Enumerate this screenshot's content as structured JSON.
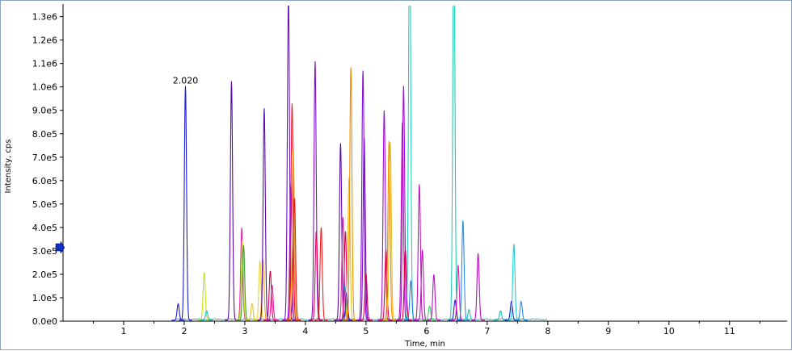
{
  "chart_data": {
    "type": "line",
    "title": "",
    "xlabel": "Time, min",
    "ylabel": "Intensity, cps",
    "xlim": [
      0,
      11.95
    ],
    "ylim": [
      0,
      1340000
    ],
    "x_ticks": [
      1,
      2,
      3,
      4,
      5,
      6,
      7,
      8,
      9,
      10,
      11
    ],
    "y_ticks": [
      0,
      100000,
      200000,
      300000,
      400000,
      500000,
      600000,
      700000,
      800000,
      900000,
      1000000,
      1100000,
      1200000,
      1300000
    ],
    "y_tick_labels": [
      "0.0e0",
      "1.0e5",
      "2.0e5",
      "3.0e5",
      "4.0e5",
      "5.0e5",
      "6.0e5",
      "7.0e5",
      "8.0e5",
      "9.0e5",
      "1.0e6",
      "1.1e6",
      "1.2e6",
      "1.3e6"
    ],
    "grid": false,
    "legend": "none",
    "annotations": [
      {
        "text": "2.020",
        "x": 2.02,
        "y": 1000000
      }
    ],
    "peaks": [
      {
        "rt": 2.02,
        "height": 1000000,
        "color": "#1c1cd0"
      },
      {
        "rt": 1.9,
        "height": 70000,
        "color": "#1c1cd0"
      },
      {
        "rt": 2.33,
        "height": 205000,
        "color": "#c0e020"
      },
      {
        "rt": 2.37,
        "height": 40000,
        "color": "#20c0c0"
      },
      {
        "rt": 2.78,
        "height": 1020000,
        "color": "#5a0aa8"
      },
      {
        "rt": 2.95,
        "height": 395000,
        "color": "#e020b0"
      },
      {
        "rt": 2.96,
        "height": 340000,
        "color": "#c0e020"
      },
      {
        "rt": 2.98,
        "height": 320000,
        "color": "#40a030"
      },
      {
        "rt": 3.12,
        "height": 70000,
        "color": "#e8c020"
      },
      {
        "rt": 3.25,
        "height": 255000,
        "color": "#e8d040"
      },
      {
        "rt": 3.3,
        "height": 260000,
        "color": "#e8a020"
      },
      {
        "rt": 3.32,
        "height": 905000,
        "color": "#5a0aa8"
      },
      {
        "rt": 3.42,
        "height": 210000,
        "color": "#e00050"
      },
      {
        "rt": 3.45,
        "height": 150000,
        "color": "#e020b0"
      },
      {
        "rt": 3.72,
        "height": 1380000,
        "color": "#7010c0"
      },
      {
        "rt": 3.76,
        "height": 580000,
        "color": "#a000e0"
      },
      {
        "rt": 3.78,
        "height": 925000,
        "color": "#e82020"
      },
      {
        "rt": 3.8,
        "height": 730000,
        "color": "#e8a020"
      },
      {
        "rt": 3.82,
        "height": 520000,
        "color": "#e82020"
      },
      {
        "rt": 4.16,
        "height": 1105000,
        "color": "#8010d0"
      },
      {
        "rt": 4.18,
        "height": 380000,
        "color": "#e00050"
      },
      {
        "rt": 4.26,
        "height": 395000,
        "color": "#e82020"
      },
      {
        "rt": 4.58,
        "height": 755000,
        "color": "#5a0aa8"
      },
      {
        "rt": 4.62,
        "height": 440000,
        "color": "#e020b0"
      },
      {
        "rt": 4.65,
        "height": 150000,
        "color": "#20a0e0"
      },
      {
        "rt": 4.66,
        "height": 380000,
        "color": "#e00050"
      },
      {
        "rt": 4.68,
        "height": 115000,
        "color": "#1c1cd0"
      },
      {
        "rt": 4.72,
        "height": 610000,
        "color": "#e8c020"
      },
      {
        "rt": 4.75,
        "height": 1080000,
        "color": "#f08c00"
      },
      {
        "rt": 4.95,
        "height": 1065000,
        "color": "#8010d0"
      },
      {
        "rt": 4.97,
        "height": 780000,
        "color": "#8010d0"
      },
      {
        "rt": 5.0,
        "height": 200000,
        "color": "#e00050"
      },
      {
        "rt": 5.3,
        "height": 895000,
        "color": "#a010d0"
      },
      {
        "rt": 5.33,
        "height": 300000,
        "color": "#e00050"
      },
      {
        "rt": 5.38,
        "height": 765000,
        "color": "#f08c00"
      },
      {
        "rt": 5.4,
        "height": 760000,
        "color": "#e8c020"
      },
      {
        "rt": 5.6,
        "height": 845000,
        "color": "#c010c0"
      },
      {
        "rt": 5.62,
        "height": 1000000,
        "color": "#a010d0"
      },
      {
        "rt": 5.65,
        "height": 300000,
        "color": "#e00050"
      },
      {
        "rt": 5.72,
        "height": 1700000,
        "color": "#20d0c0"
      },
      {
        "rt": 5.74,
        "height": 170000,
        "color": "#2080e0"
      },
      {
        "rt": 5.88,
        "height": 580000,
        "color": "#c010c0"
      },
      {
        "rt": 5.93,
        "height": 300000,
        "color": "#c010c0"
      },
      {
        "rt": 6.05,
        "height": 60000,
        "color": "#40d060"
      },
      {
        "rt": 6.12,
        "height": 195000,
        "color": "#c010c0"
      },
      {
        "rt": 6.45,
        "height": 1700000,
        "color": "#20d0b0"
      },
      {
        "rt": 6.47,
        "height": 85000,
        "color": "#1c1cd0"
      },
      {
        "rt": 6.52,
        "height": 235000,
        "color": "#e020b0"
      },
      {
        "rt": 6.6,
        "height": 425000,
        "color": "#2090e0"
      },
      {
        "rt": 6.7,
        "height": 45000,
        "color": "#20c0c0"
      },
      {
        "rt": 6.85,
        "height": 285000,
        "color": "#c010c0"
      },
      {
        "rt": 7.22,
        "height": 40000,
        "color": "#20c0c0"
      },
      {
        "rt": 7.4,
        "height": 80000,
        "color": "#1c1cd0"
      },
      {
        "rt": 7.44,
        "height": 325000,
        "color": "#20d0d0"
      },
      {
        "rt": 7.56,
        "height": 80000,
        "color": "#2090e0"
      }
    ]
  }
}
